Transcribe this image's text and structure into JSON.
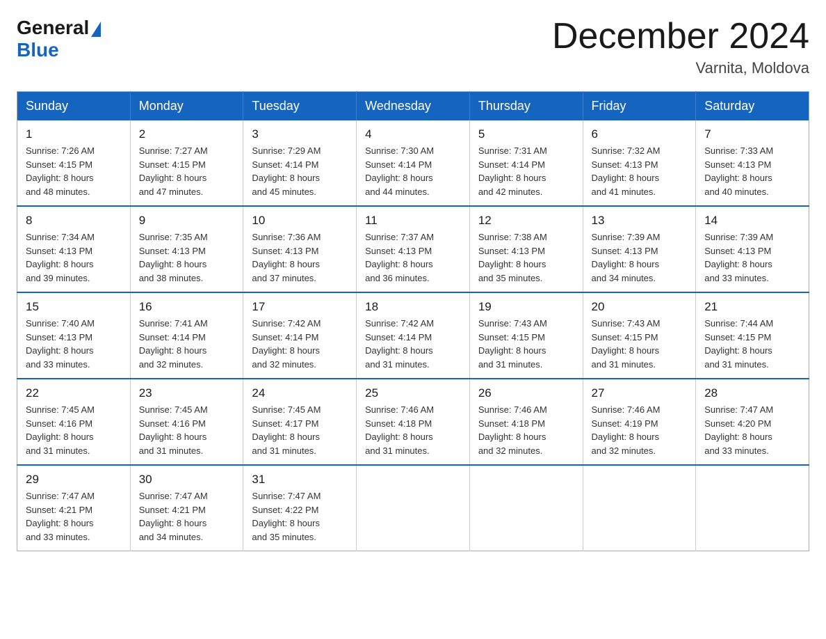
{
  "header": {
    "logo_general": "General",
    "logo_blue": "Blue",
    "month_title": "December 2024",
    "location": "Varnita, Moldova"
  },
  "days_of_week": [
    "Sunday",
    "Monday",
    "Tuesday",
    "Wednesday",
    "Thursday",
    "Friday",
    "Saturday"
  ],
  "weeks": [
    [
      {
        "day": "1",
        "sunrise": "7:26 AM",
        "sunset": "4:15 PM",
        "daylight": "8 hours and 48 minutes."
      },
      {
        "day": "2",
        "sunrise": "7:27 AM",
        "sunset": "4:15 PM",
        "daylight": "8 hours and 47 minutes."
      },
      {
        "day": "3",
        "sunrise": "7:29 AM",
        "sunset": "4:14 PM",
        "daylight": "8 hours and 45 minutes."
      },
      {
        "day": "4",
        "sunrise": "7:30 AM",
        "sunset": "4:14 PM",
        "daylight": "8 hours and 44 minutes."
      },
      {
        "day": "5",
        "sunrise": "7:31 AM",
        "sunset": "4:14 PM",
        "daylight": "8 hours and 42 minutes."
      },
      {
        "day": "6",
        "sunrise": "7:32 AM",
        "sunset": "4:13 PM",
        "daylight": "8 hours and 41 minutes."
      },
      {
        "day": "7",
        "sunrise": "7:33 AM",
        "sunset": "4:13 PM",
        "daylight": "8 hours and 40 minutes."
      }
    ],
    [
      {
        "day": "8",
        "sunrise": "7:34 AM",
        "sunset": "4:13 PM",
        "daylight": "8 hours and 39 minutes."
      },
      {
        "day": "9",
        "sunrise": "7:35 AM",
        "sunset": "4:13 PM",
        "daylight": "8 hours and 38 minutes."
      },
      {
        "day": "10",
        "sunrise": "7:36 AM",
        "sunset": "4:13 PM",
        "daylight": "8 hours and 37 minutes."
      },
      {
        "day": "11",
        "sunrise": "7:37 AM",
        "sunset": "4:13 PM",
        "daylight": "8 hours and 36 minutes."
      },
      {
        "day": "12",
        "sunrise": "7:38 AM",
        "sunset": "4:13 PM",
        "daylight": "8 hours and 35 minutes."
      },
      {
        "day": "13",
        "sunrise": "7:39 AM",
        "sunset": "4:13 PM",
        "daylight": "8 hours and 34 minutes."
      },
      {
        "day": "14",
        "sunrise": "7:39 AM",
        "sunset": "4:13 PM",
        "daylight": "8 hours and 33 minutes."
      }
    ],
    [
      {
        "day": "15",
        "sunrise": "7:40 AM",
        "sunset": "4:13 PM",
        "daylight": "8 hours and 33 minutes."
      },
      {
        "day": "16",
        "sunrise": "7:41 AM",
        "sunset": "4:14 PM",
        "daylight": "8 hours and 32 minutes."
      },
      {
        "day": "17",
        "sunrise": "7:42 AM",
        "sunset": "4:14 PM",
        "daylight": "8 hours and 32 minutes."
      },
      {
        "day": "18",
        "sunrise": "7:42 AM",
        "sunset": "4:14 PM",
        "daylight": "8 hours and 31 minutes."
      },
      {
        "day": "19",
        "sunrise": "7:43 AM",
        "sunset": "4:15 PM",
        "daylight": "8 hours and 31 minutes."
      },
      {
        "day": "20",
        "sunrise": "7:43 AM",
        "sunset": "4:15 PM",
        "daylight": "8 hours and 31 minutes."
      },
      {
        "day": "21",
        "sunrise": "7:44 AM",
        "sunset": "4:15 PM",
        "daylight": "8 hours and 31 minutes."
      }
    ],
    [
      {
        "day": "22",
        "sunrise": "7:45 AM",
        "sunset": "4:16 PM",
        "daylight": "8 hours and 31 minutes."
      },
      {
        "day": "23",
        "sunrise": "7:45 AM",
        "sunset": "4:16 PM",
        "daylight": "8 hours and 31 minutes."
      },
      {
        "day": "24",
        "sunrise": "7:45 AM",
        "sunset": "4:17 PM",
        "daylight": "8 hours and 31 minutes."
      },
      {
        "day": "25",
        "sunrise": "7:46 AM",
        "sunset": "4:18 PM",
        "daylight": "8 hours and 31 minutes."
      },
      {
        "day": "26",
        "sunrise": "7:46 AM",
        "sunset": "4:18 PM",
        "daylight": "8 hours and 32 minutes."
      },
      {
        "day": "27",
        "sunrise": "7:46 AM",
        "sunset": "4:19 PM",
        "daylight": "8 hours and 32 minutes."
      },
      {
        "day": "28",
        "sunrise": "7:47 AM",
        "sunset": "4:20 PM",
        "daylight": "8 hours and 33 minutes."
      }
    ],
    [
      {
        "day": "29",
        "sunrise": "7:47 AM",
        "sunset": "4:21 PM",
        "daylight": "8 hours and 33 minutes."
      },
      {
        "day": "30",
        "sunrise": "7:47 AM",
        "sunset": "4:21 PM",
        "daylight": "8 hours and 34 minutes."
      },
      {
        "day": "31",
        "sunrise": "7:47 AM",
        "sunset": "4:22 PM",
        "daylight": "8 hours and 35 minutes."
      },
      null,
      null,
      null,
      null
    ]
  ],
  "labels": {
    "sunrise": "Sunrise:",
    "sunset": "Sunset:",
    "daylight": "Daylight:"
  }
}
